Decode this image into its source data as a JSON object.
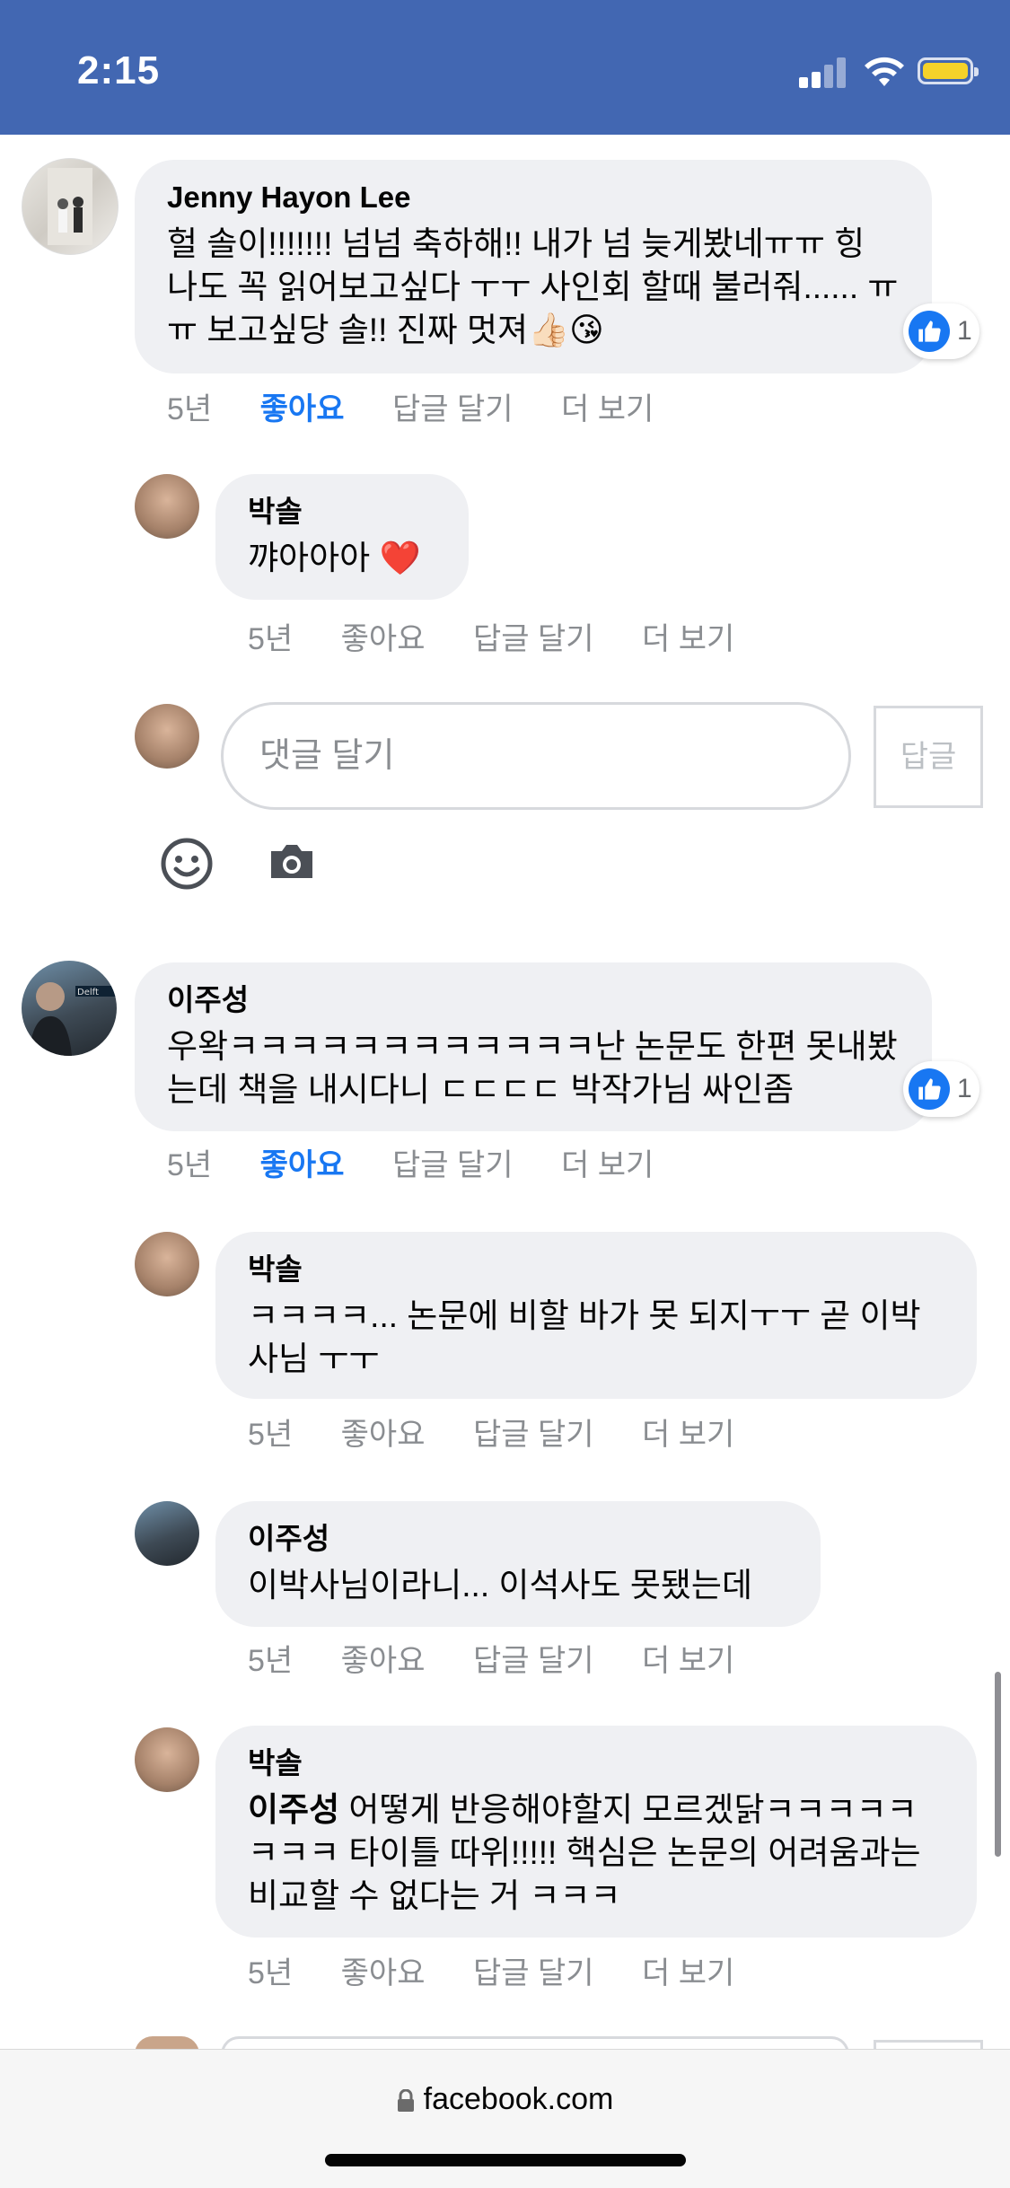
{
  "status_bar": {
    "time": "2:15"
  },
  "comments": [
    {
      "author": "Jenny Hayon Lee",
      "text": "헐 솔이!!!!!!! 넘넘 축하해!! 내가 넘 늦게봤네ㅠㅠ 힝 나도 꼭 읽어보고싶다 ㅜㅜ 사인회 할때 불러줘...... ㅠㅠ 보고싶당 솔!! 진짜 멋져👍🏻😘",
      "reaction_count": "1",
      "time": "5년",
      "like": "좋아요",
      "reply": "답글 달기",
      "more": "더 보기"
    },
    {
      "author": "이주성",
      "text": "우왁ㅋㅋㅋㅋㅋㅋㅋㅋㅋㅋㅋㅋ난 논문도 한편 못내봤는데 책을 내시다니 ㄷㄷㄷㄷ 박작가님 싸인좀",
      "reaction_count": "1",
      "time": "5년",
      "like": "좋아요",
      "reply": "답글 달기",
      "more": "더 보기"
    }
  ],
  "replies": [
    {
      "author": "박솔",
      "text": "꺄아아아 ❤️",
      "time": "5년",
      "like": "좋아요",
      "reply": "답글 달기",
      "more": "더 보기"
    },
    {
      "author": "박솔",
      "text": "ㅋㅋㅋㅋ... 논문에 비할 바가 못 되지ㅜㅜ 곧 이박사님 ㅜㅜ",
      "time": "5년",
      "like": "좋아요",
      "reply": "답글 달기",
      "more": "더 보기"
    },
    {
      "author": "이주성",
      "text": "이박사님이라니... 이석사도 못됐는데",
      "time": "5년",
      "like": "좋아요",
      "reply": "답글 달기",
      "more": "더 보기"
    },
    {
      "author": "박솔",
      "mention": "이주성",
      "text": " 어떻게 반응해야할지 모르겠닭ㅋㅋㅋㅋㅋㅋㅋㅋ 타이틀 따위!!!!! 핵심은 논문의 어려움과는 비교할 수 없다는 거 ㅋㅋㅋ",
      "time": "5년",
      "like": "좋아요",
      "reply": "답글 달기",
      "more": "더 보기"
    }
  ],
  "reply_box": {
    "placeholder": "댓글 달기",
    "button": "답글"
  },
  "browser": {
    "url": "facebook.com"
  },
  "colors": {
    "header": "#4267b2",
    "like_active": "#1877f2",
    "bubble": "#eff0f3"
  }
}
